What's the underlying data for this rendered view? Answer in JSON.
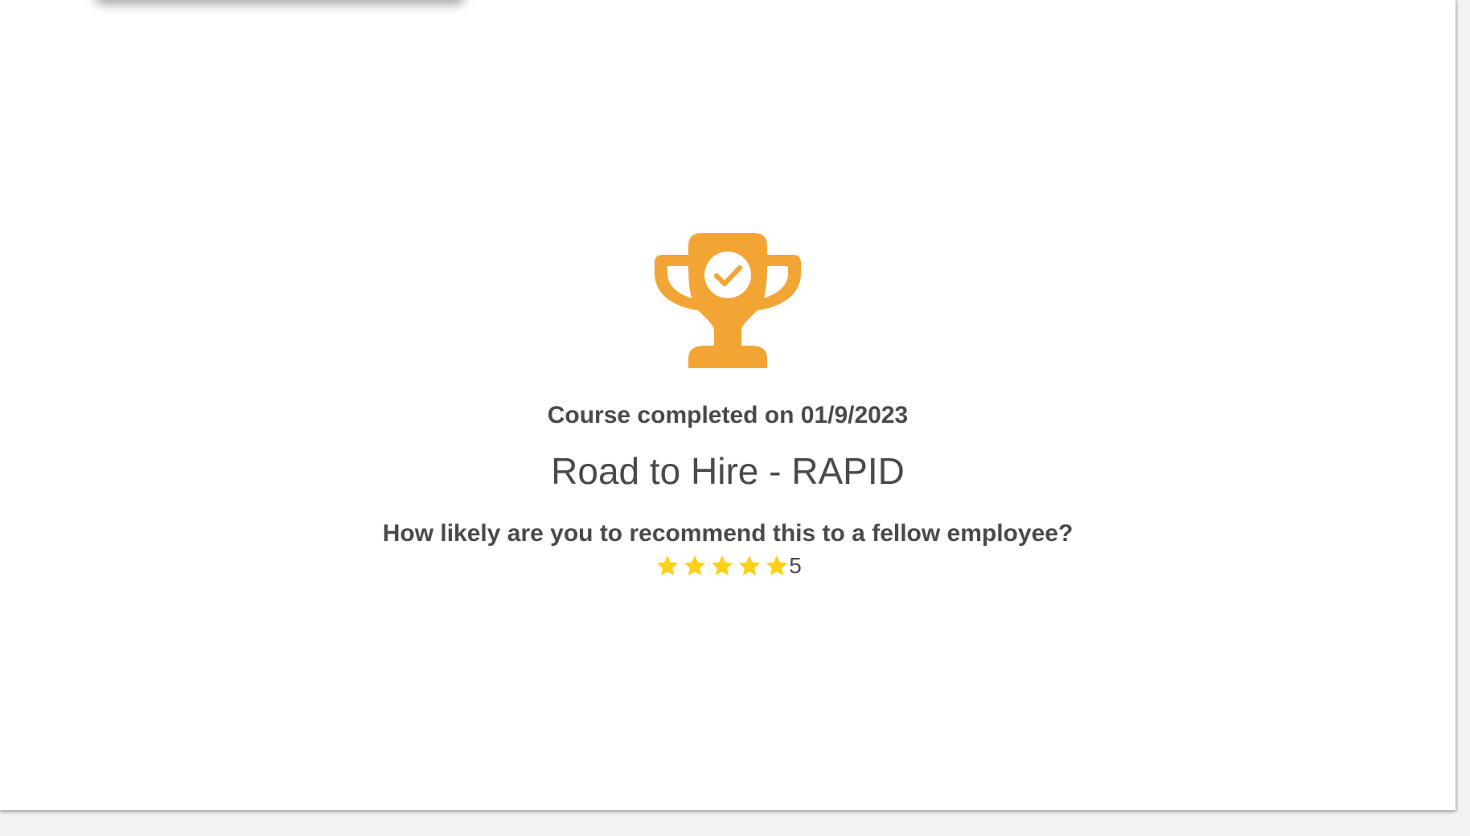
{
  "completion": {
    "text": "Course completed on 01/9/2023"
  },
  "course": {
    "title": "Road to Hire - RAPID"
  },
  "survey": {
    "question": "How likely are you to recommend this to a fellow employee?",
    "rating_value": "5",
    "stars_filled": 5,
    "stars_total": 5
  },
  "colors": {
    "trophy": "#f2a535",
    "star": "#fcd116",
    "text": "#4a4a4a"
  },
  "icons": {
    "trophy": "trophy-check-icon",
    "star": "star-icon"
  }
}
